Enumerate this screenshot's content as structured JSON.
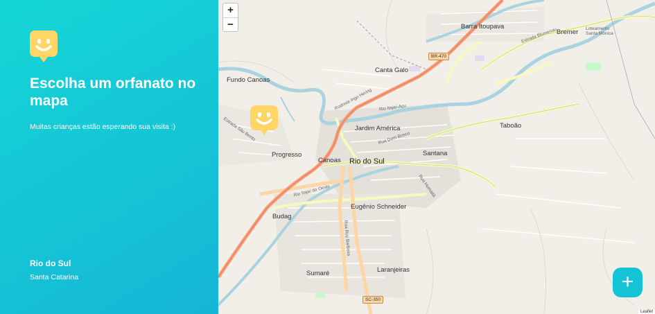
{
  "sidebar": {
    "headline": "Escolha um orfanato no mapa",
    "subtitle": "Muitas crianças estão esperando sua visita :)",
    "location": {
      "city": "Rio do Sul",
      "state": "Santa Catarina"
    }
  },
  "map": {
    "zoom_in": "+",
    "zoom_out": "−",
    "attribution": "Leaflet",
    "labels": {
      "barra_itoupava": "Barra Itoupava",
      "bremer": "Bremer",
      "loteamento_line1": "Loteamento",
      "loteamento_line2": "Santa Mônica",
      "canta_galo": "Canta Galo",
      "fundo_canoas": "Fundo Canoas",
      "jardim_america": "Jardim América",
      "taboao": "Taboão",
      "progresso": "Progresso",
      "canoas": "Canoas",
      "rio_do_sul": "Rio do Sul",
      "santana": "Santana",
      "eugenio_schneider": "Eugênio Schneider",
      "budag": "Budag",
      "sumare": "Sumaré",
      "laranjeiras": "Laranjeiras",
      "rio_itajai_acu": "Rio Itajaí-Açu",
      "rio_itajai_do_oeste": "Rio Itajaí do Oeste",
      "rodovia_ingo_hering": "Rodovia Ingo Hering",
      "estrada_blumenau": "Estrada Blumenau",
      "rua_dom_bosco": "Rua Dom Bosco",
      "rua_humaita": "Rua Humaitá",
      "rua_barbosa": "Rua Ruy Barbosa",
      "estrada_sao_bento": "Estrada São Bento",
      "br_470": "BR-470",
      "sc_350": "SC-350"
    }
  },
  "fab": {
    "label": "+"
  },
  "colors": {
    "brand": "#15c3d6",
    "pin": "#ffd666"
  }
}
